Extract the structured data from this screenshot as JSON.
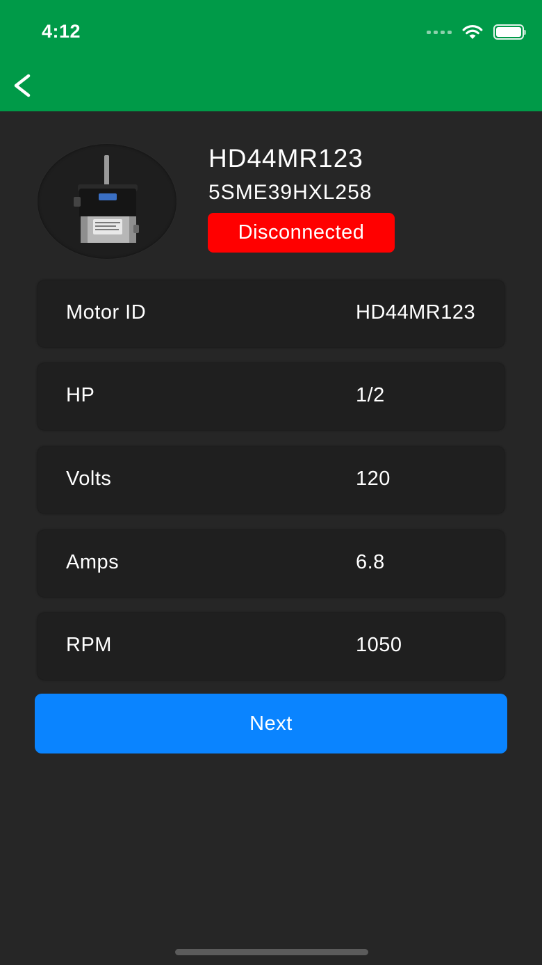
{
  "status_bar": {
    "time": "4:12"
  },
  "header": {
    "back_icon": "chevron-left-icon"
  },
  "motor": {
    "image_icon": "motor-image",
    "title": "HD44MR123",
    "serial": "5SME39HXL258",
    "status": "Disconnected"
  },
  "specs": [
    {
      "label": "Motor ID",
      "value": "HD44MR123"
    },
    {
      "label": "HP",
      "value": "1/2"
    },
    {
      "label": "Volts",
      "value": "120"
    },
    {
      "label": "Amps",
      "value": "6.8"
    },
    {
      "label": "RPM",
      "value": "1050"
    }
  ],
  "actions": {
    "next_label": "Next"
  },
  "colors": {
    "header_bg": "#009a48",
    "background": "#262626",
    "card_bg": "#1f1f1f",
    "status_red": "#ff0000",
    "button_blue": "#0a84ff"
  }
}
